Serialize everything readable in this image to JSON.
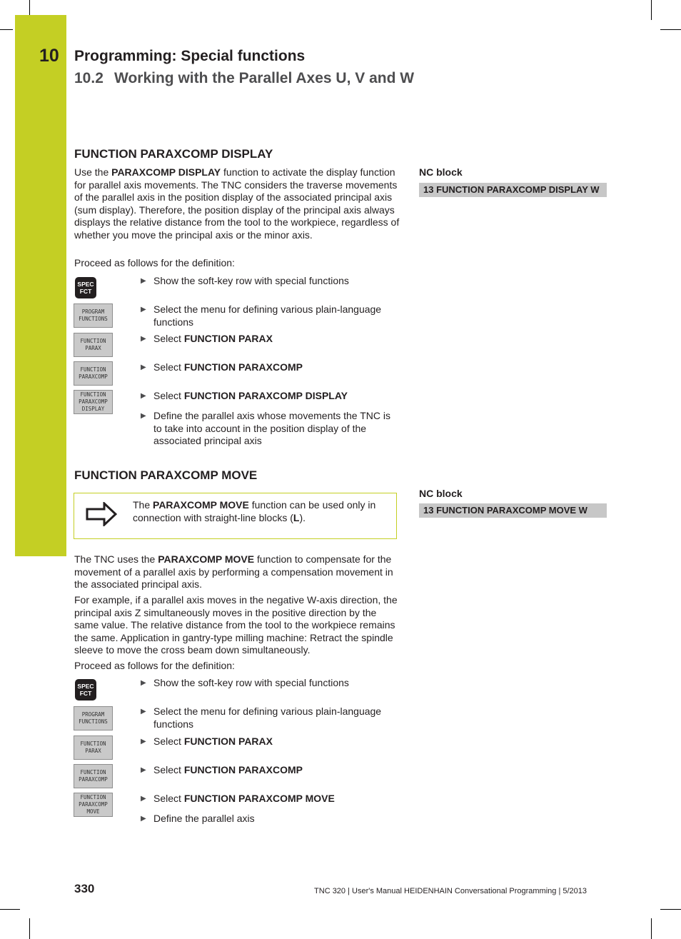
{
  "header": {
    "chapter_number": "10",
    "chapter_title": "Programming: Special functions",
    "section_number": "10.2",
    "section_title": "Working with the Parallel Axes U, V and W"
  },
  "section_display": {
    "heading": "FUNCTION PARAXCOMP DISPLAY",
    "intro": {
      "pre": "Use the ",
      "bold": "PARAXCOMP DISPLAY",
      "post": " function to activate the display function for parallel axis movements. The TNC considers the traverse movements of the parallel axis in the position display of the associated principal axis (sum display). Therefore, the position display of the principal axis always displays the relative distance from the tool to the workpiece, regardless of whether you move the principal axis or the minor axis."
    },
    "proceed": "Proceed as follows for the definition:",
    "nc_label": "NC block",
    "nc_block": "13 FUNCTION PARAXCOMP DISPLAY W",
    "keys": [
      {
        "type": "hardkey",
        "lines": [
          "SPEC",
          "FCT"
        ]
      },
      {
        "type": "softkey",
        "lines": [
          "PROGRAM",
          "FUNCTIONS"
        ]
      },
      {
        "type": "softkey",
        "lines": [
          "FUNCTION",
          "PARAX"
        ]
      },
      {
        "type": "softkey",
        "lines": [
          "FUNCTION",
          "PARAXCOMP"
        ]
      },
      {
        "type": "softkey",
        "lines": [
          "FUNCTION",
          "PARAXCOMP",
          "DISPLAY"
        ]
      }
    ],
    "steps": [
      {
        "pre": "Show the soft-key row with special functions",
        "bold": ""
      },
      {
        "pre": "Select the menu for defining various plain-language functions",
        "bold": ""
      },
      {
        "pre": "Select ",
        "bold": "FUNCTION PARAX"
      },
      {
        "pre": "Select ",
        "bold": "FUNCTION PARAXCOMP"
      },
      {
        "pre": "Select ",
        "bold": "FUNCTION PARAXCOMP DISPLAY"
      },
      {
        "pre": "Define the parallel axis whose movements the TNC is to take into account in the position display of the associated principal axis",
        "bold": ""
      }
    ]
  },
  "section_move": {
    "heading": "FUNCTION PARAXCOMP MOVE",
    "note": {
      "icon": "arrow-right-outline-icon",
      "pre": "The ",
      "bold1": "PARAXCOMP MOVE",
      "mid": " function can be used only in connection with straight-line blocks (",
      "bold2": "L",
      "post": ")."
    },
    "para1": {
      "pre": "The TNC uses the ",
      "bold": "PARAXCOMP MOVE",
      "post": " function to compensate for the movement of a parallel axis by performing a compensation movement in the associated principal axis."
    },
    "para2": "For example, if a parallel axis moves in the negative W-axis direction, the principal axis Z simultaneously moves in the positive direction by the same value. The relative distance from the tool to the workpiece remains the same. Application in gantry-type milling machine: Retract the spindle sleeve to move the cross beam down simultaneously.",
    "proceed": "Proceed as follows for the definition:",
    "nc_label": "NC block",
    "nc_block": "13 FUNCTION PARAXCOMP MOVE W",
    "keys": [
      {
        "type": "hardkey",
        "lines": [
          "SPEC",
          "FCT"
        ]
      },
      {
        "type": "softkey",
        "lines": [
          "PROGRAM",
          "FUNCTIONS"
        ]
      },
      {
        "type": "softkey",
        "lines": [
          "FUNCTION",
          "PARAX"
        ]
      },
      {
        "type": "softkey",
        "lines": [
          "FUNCTION",
          "PARAXCOMP"
        ]
      },
      {
        "type": "softkey",
        "lines": [
          "FUNCTION",
          "PARAXCOMP",
          "MOVE"
        ]
      }
    ],
    "steps": [
      {
        "pre": "Show the soft-key row with special functions",
        "bold": ""
      },
      {
        "pre": "Select the menu for defining various plain-language functions",
        "bold": ""
      },
      {
        "pre": "Select ",
        "bold": "FUNCTION PARAX"
      },
      {
        "pre": "Select ",
        "bold": "FUNCTION PARAXCOMP"
      },
      {
        "pre": "Select ",
        "bold": "FUNCTION PARAXCOMP MOVE"
      },
      {
        "pre": "Define the parallel axis",
        "bold": ""
      }
    ]
  },
  "footer": {
    "page_number": "330",
    "text": "TNC 320 | User's Manual HEIDENHAIN Conversational Programming | 5/2013"
  },
  "colors": {
    "accent_green": "#c4cf24",
    "nc_block_bg": "#c7c7c7",
    "softkey_bg": "#c9c9c9",
    "hardkey_bg": "#231f20"
  }
}
